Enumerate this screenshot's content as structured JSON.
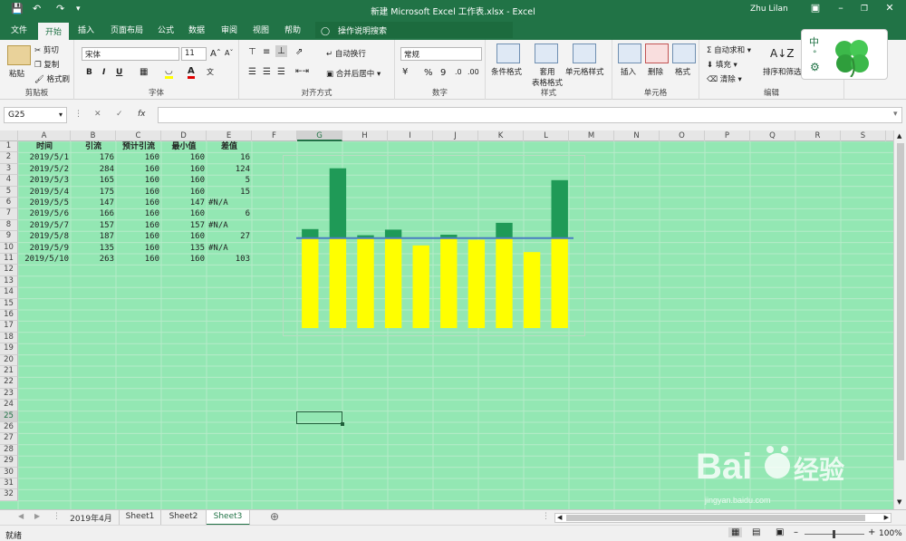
{
  "app": {
    "window_title": "新建 Microsoft Excel 工作表.xlsx  -  Excel",
    "user_name": "Zhu Lilan"
  },
  "ribbon_tabs": [
    "文件",
    "开始",
    "插入",
    "页面布局",
    "公式",
    "数据",
    "审阅",
    "视图",
    "帮助"
  ],
  "tell_me": "操作说明搜索",
  "ribbon": {
    "clipboard": {
      "paste": "粘贴",
      "cut": "剪切",
      "copy": "复制",
      "format_painter": "格式刷",
      "label": "剪贴板"
    },
    "font": {
      "name": "宋体",
      "size": "11",
      "bold": "B",
      "italic": "I",
      "underline": "U",
      "label": "字体"
    },
    "alignment": {
      "wrap": "自动换行",
      "merge": "合并后居中",
      "label": "对齐方式"
    },
    "number": {
      "format": "常规",
      "percent": "%",
      "comma": "9",
      "label": "数字"
    },
    "styles": {
      "conditional": "条件格式",
      "table": "套用\n表格格式",
      "cell_styles": "单元格样式",
      "label": "样式"
    },
    "cells": {
      "insert": "插入",
      "delete": "删除",
      "format": "格式",
      "label": "单元格"
    },
    "editing": {
      "autosum": "自动求和",
      "fill": "填充",
      "clear": "清除",
      "sort": "排序和筛选",
      "label": "编辑"
    }
  },
  "input_widget": {
    "text": "中"
  },
  "formula_bar": {
    "name_box": "G25",
    "cancel": "✕",
    "enter": "✓",
    "fx": "fx",
    "value": ""
  },
  "columns": [
    "A",
    "B",
    "C",
    "D",
    "E",
    "F",
    "G",
    "H",
    "I",
    "J",
    "K",
    "L",
    "M",
    "N",
    "O",
    "P",
    "Q",
    "R",
    "S"
  ],
  "selected_column": "G",
  "selected_row": 25,
  "row_count": 32,
  "table": {
    "headers": [
      "时间",
      "引流",
      "预计引流",
      "最小值",
      "差值"
    ],
    "rows": [
      [
        "2019/5/1",
        "176",
        "160",
        "160",
        "16"
      ],
      [
        "2019/5/2",
        "284",
        "160",
        "160",
        "124"
      ],
      [
        "2019/5/3",
        "165",
        "160",
        "160",
        "5"
      ],
      [
        "2019/5/4",
        "175",
        "160",
        "160",
        "15"
      ],
      [
        "2019/5/5",
        "147",
        "160",
        "147",
        "#N/A"
      ],
      [
        "2019/5/6",
        "166",
        "160",
        "160",
        "6"
      ],
      [
        "2019/5/7",
        "157",
        "160",
        "157",
        "#N/A"
      ],
      [
        "2019/5/8",
        "187",
        "160",
        "160",
        "27"
      ],
      [
        "2019/5/9",
        "135",
        "160",
        "135",
        "#N/A"
      ],
      [
        "2019/5/10",
        "263",
        "160",
        "160",
        "103"
      ]
    ]
  },
  "chart_data": {
    "type": "bar",
    "stacked": true,
    "categories": [
      "2019/5/1",
      "2019/5/2",
      "2019/5/3",
      "2019/5/4",
      "2019/5/5",
      "2019/5/6",
      "2019/5/7",
      "2019/5/8",
      "2019/5/9",
      "2019/5/10"
    ],
    "series": [
      {
        "values": [
          160,
          160,
          160,
          160,
          147,
          160,
          157,
          160,
          135,
          160
        ],
        "color": "#ffff00"
      },
      {
        "values": [
          16,
          124,
          5,
          15,
          0,
          6,
          0,
          27,
          0,
          103
        ],
        "color": "#1f9a57"
      }
    ],
    "reference_line": {
      "value": 160,
      "color": "#4a7fc1"
    },
    "ylim": [
      0,
      290
    ],
    "axes_visible": false,
    "background": "#93e7b3"
  },
  "sheet_tabs": [
    "2019年4月",
    "Sheet1",
    "Sheet2",
    "Sheet3"
  ],
  "active_sheet": "Sheet3",
  "status": {
    "mode": "就绪",
    "zoom": "100%"
  },
  "colors": {
    "excel_green": "#217346",
    "sheet_bg": "#93e7b3"
  }
}
